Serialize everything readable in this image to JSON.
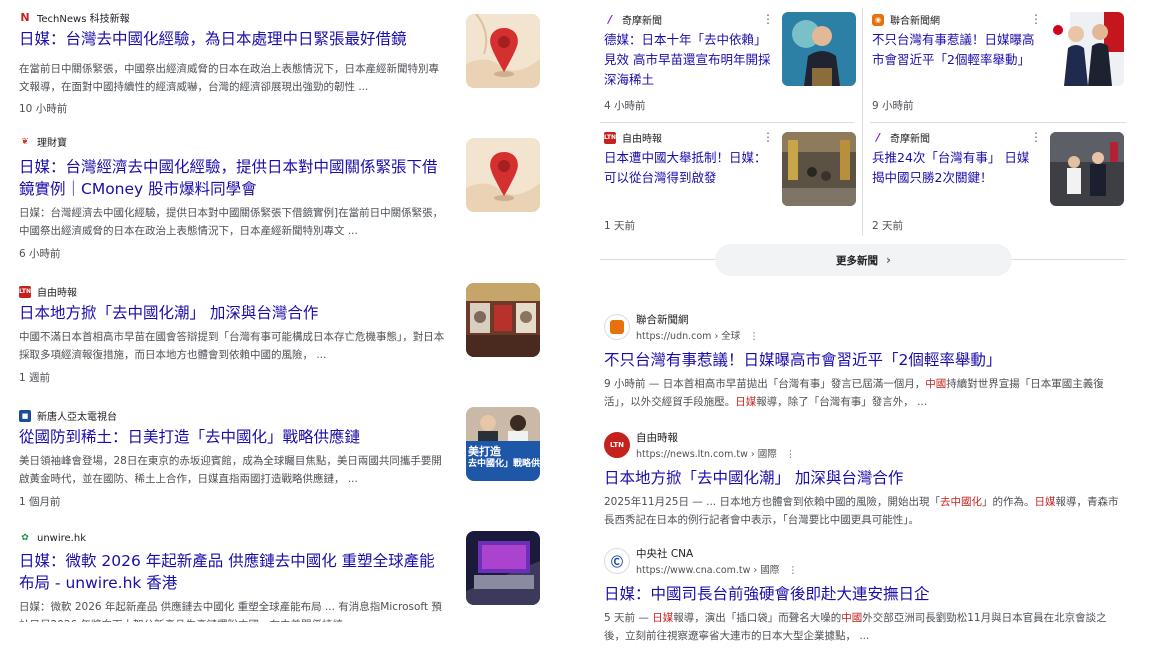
{
  "left_results": [
    {
      "source": "TechNews 科技新報",
      "title": "日媒：台灣去中國化經驗，為日本處理中日緊張最好借鏡",
      "snippet": "在當前日中關係緊張，中國祭出經濟威脅的日本在政治上表態情況下，日本產經新聞特別專文報導，在面對中國持續性的經濟威嚇，台灣的經濟卻展現出強勁的韌性 ...",
      "time": "10 小時前"
    },
    {
      "source": "理財寶",
      "title": "日媒：台灣經濟去中國化經驗，提供日本對中國關係緊張下借鏡實例｜CMoney 股市爆料同學會",
      "snippet": "日媒：台灣經濟去中國化經驗，提供日本對中國關係緊張下借鏡實例]在當前日中關係緊張，中國祭出經濟威脅的日本在政治上表態情況下，日本產經新聞特別專文 ...",
      "time": "6 小時前"
    },
    {
      "source": "自由時報",
      "title": "日本地方掀「去中國化潮」 加深與台灣合作",
      "snippet": "中國不滿日本首相高市早苗在國會答辯提到「台灣有事可能構成日本存亡危機事態」，對日本採取多項經濟報復措施，而日本地方也體會到依賴中國的風險， ...",
      "time": "1 週前"
    },
    {
      "source": "新唐人亞太電視台",
      "title": "從國防到稀土：日美打造「去中國化」戰略供應鏈",
      "snippet": "美日領袖峰會登場，28日在東京的赤坂迎賓館，成為全球矚目焦點，美日兩國共同攜手要開啟黃金時代，並在國防、稀土上合作，日媒直指兩國打造戰略供應鏈， ...",
      "time": "1 個月前"
    },
    {
      "source": "unwire.hk",
      "title": "日媒：微軟 2026 年起新產品 供應鏈去中國化 重塑全球產能布局 - unwire.hk 香港",
      "snippet": "日媒：微軟 2026 年起新產品 供應鏈去中國化 重塑全球產能布局 ... 有消息指Microsoft 預計目尽2026 年將向下士架分新產品生產鏈擺脫中國，在中美關係持續 ...",
      "time": ""
    }
  ],
  "thumb_texts": {
    "line1": "美打造",
    "line2": "去中國化」戰略供"
  },
  "top_grid": [
    {
      "source": "奇摩新聞",
      "title": "德媒：日本十年「去中依賴」見效 高市早苗還宣布明年開採深海稀土",
      "time": "4 小時前"
    },
    {
      "source": "聯合新聞網",
      "title": "不只台灣有事惹議！日媒曝高市會習近平「2個輕率舉動」",
      "time": "9 小時前"
    },
    {
      "source": "自由時報",
      "title": "日本遭中國大舉抵制！日媒：可以從台灣得到啟發",
      "time": "1 天前"
    },
    {
      "source": "奇摩新聞",
      "title": "兵推24次「台灣有事」 日媒揭中國只勝2次關鍵！",
      "time": "2 天前"
    }
  ],
  "more_news": "更多新聞",
  "right_results": [
    {
      "logo": "UDN",
      "name": "聯合新聞網",
      "url": "https://udn.com › 全球",
      "title": "不只台灣有事惹議！日媒曝高市會習近平「2個輕率舉動」",
      "snippet": [
        {
          "t": "9 小時前 — 日本首相高市早苗拋出「台灣有事」發言已屆滿一個月，"
        },
        {
          "t": "中國",
          "h": true
        },
        {
          "t": "持續對世界宣揚「日本軍國主義復活」，以外交經貿手段施壓。"
        },
        {
          "t": "日媒",
          "h": true
        },
        {
          "t": "報導，除了「台灣有事」發言外， ..."
        }
      ]
    },
    {
      "logo": "LTN",
      "name": "自由時報",
      "url": "https://news.ltn.com.tw › 國際",
      "title": "日本地方掀「去中國化潮」 加深與台灣合作",
      "snippet": [
        {
          "t": "2025年11月25日 — ... 日本地方也體會到依賴中國的風險，開始出現「"
        },
        {
          "t": "去中國化",
          "h": true
        },
        {
          "t": "」的作為。"
        },
        {
          "t": "日媒",
          "h": true
        },
        {
          "t": "報導，青森市長西秀記在日本的例行記者會中表示，「台灣要比中國更具可能性」。"
        }
      ]
    },
    {
      "logo": "CNA",
      "name": "中央社 CNA",
      "url": "https://www.cna.com.tw › 國際",
      "title": "日媒：中國司長台前強硬會後即赴大連安撫日企",
      "snippet": [
        {
          "t": "5 天前 — "
        },
        {
          "t": "日媒",
          "h": true
        },
        {
          "t": "報導，演出「插口袋」而聲名大噪的"
        },
        {
          "t": "中國",
          "h": true
        },
        {
          "t": "外交部亞洲司長劉勁松11月與日本官員在北京會談之後，立刻前往視察遼寧省大連市的日本大型企業據點， ..."
        }
      ]
    }
  ]
}
